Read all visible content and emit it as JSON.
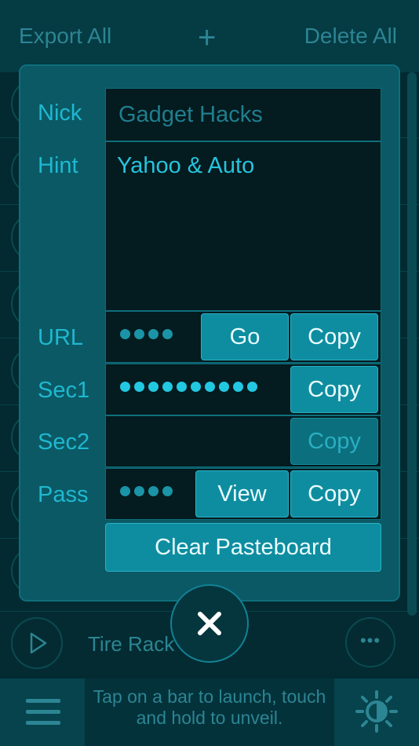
{
  "topbar": {
    "export_label": "Export All",
    "add_icon": "+",
    "delete_label": "Delete All"
  },
  "background_list": {
    "visible_item_label": "Tire Rack",
    "more_icon": "•••"
  },
  "bottombar": {
    "hint": "Tap on a bar to launch, touch and hold to unveil."
  },
  "modal": {
    "nick": {
      "label": "Nick",
      "placeholder": "Gadget Hacks",
      "value": ""
    },
    "hint": {
      "label": "Hint",
      "value": "Yahoo & Auto"
    },
    "url": {
      "label": "URL",
      "masked_length": 4,
      "go_label": "Go",
      "copy_label": "Copy"
    },
    "sec1": {
      "label": "Sec1",
      "masked_length": 10,
      "copy_label": "Copy"
    },
    "sec2": {
      "label": "Sec2",
      "masked_length": 0,
      "copy_label": "Copy"
    },
    "pass": {
      "label": "Pass",
      "masked_length": 4,
      "view_label": "View",
      "copy_label": "Copy"
    },
    "clear_label": "Clear Pasteboard"
  },
  "colors": {
    "modal_bg": "#0a5965",
    "accent": "#1fb8d0",
    "button": "#0e8da0",
    "field_bg": "#041b1f"
  },
  "icons": {
    "close": "close-icon",
    "menu": "hamburger-icon",
    "theme": "sun-moon-icon",
    "play": "play-icon"
  }
}
